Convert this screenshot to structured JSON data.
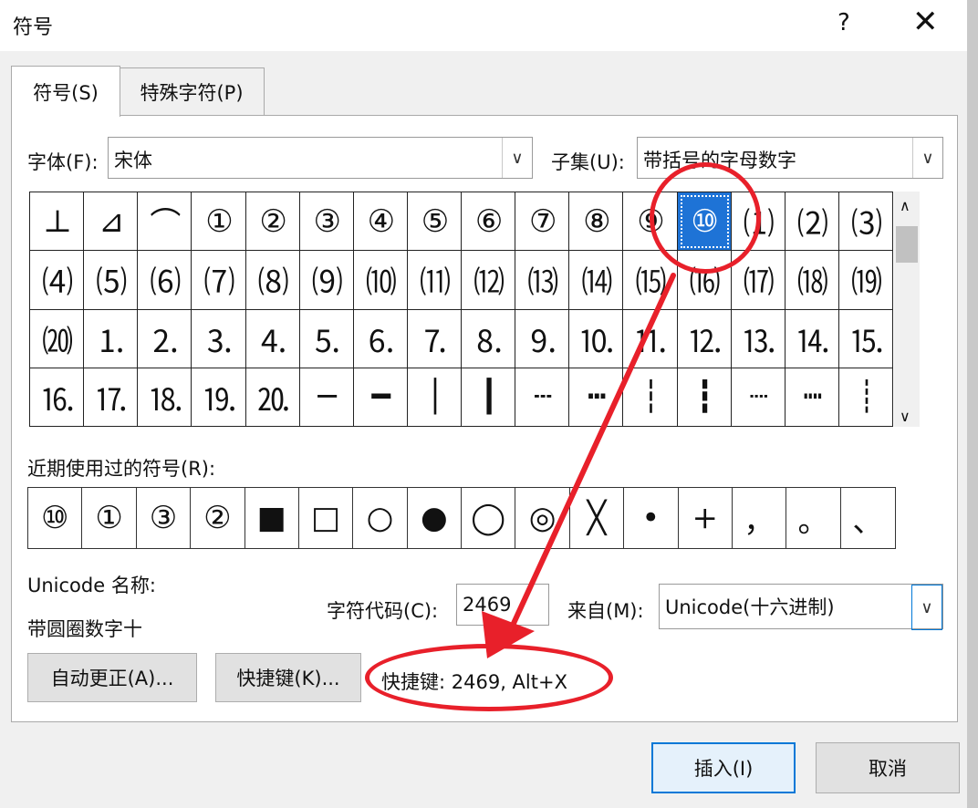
{
  "dialog": {
    "title": "符号",
    "help": "?",
    "close": "✕"
  },
  "tabs": [
    {
      "label": "符号(S)"
    },
    {
      "label": "特殊字符(P)"
    }
  ],
  "font": {
    "label": "字体(F):",
    "value": "宋体"
  },
  "subset": {
    "label": "子集(U):",
    "value": "带括号的字母数字"
  },
  "symbols": [
    "⊥",
    "⊿",
    "⌒",
    "①",
    "②",
    "③",
    "④",
    "⑤",
    "⑥",
    "⑦",
    "⑧",
    "⑨",
    "⑩",
    "⑴",
    "⑵",
    "⑶",
    "⑷",
    "⑸",
    "⑹",
    "⑺",
    "⑻",
    "⑼",
    "⑽",
    "⑾",
    "⑿",
    "⒀",
    "⒁",
    "⒂",
    "⒃",
    "⒄",
    "⒅",
    "⒆",
    "⒇",
    "⒈",
    "⒉",
    "⒊",
    "⒋",
    "⒌",
    "⒍",
    "⒎",
    "⒏",
    "⒐",
    "⒑",
    "⒒",
    "⒓",
    "⒔",
    "⒕",
    "⒖",
    "⒗",
    "⒘",
    "⒙",
    "⒚",
    "⒛",
    "─",
    "━",
    "│",
    "┃",
    "┄",
    "┅",
    "┆",
    "┇",
    "┈",
    "┉",
    "┊"
  ],
  "selected_index": 12,
  "recent": {
    "label": "近期使用过的符号(R):",
    "items": [
      "⑩",
      "①",
      "③",
      "②",
      "■",
      "□",
      "○",
      "●",
      "◯",
      "◎",
      "╳",
      "•",
      "+",
      "，",
      "。",
      "、"
    ]
  },
  "unicode_name": {
    "label": "Unicode 名称:",
    "value": "带圆圈数字十"
  },
  "char_code": {
    "label": "字符代码(C):",
    "value": "2469"
  },
  "from": {
    "label": "来自(M):",
    "value": "Unicode(十六进制)"
  },
  "buttons": {
    "autocorrect": "自动更正(A)...",
    "shortcut": "快捷键(K)...",
    "insert": "插入(I)",
    "cancel": "取消"
  },
  "shortcut_text": "快捷键: 2469, Alt+X",
  "annotation_color": "#e8202a",
  "selection_color": "#1e73d6"
}
